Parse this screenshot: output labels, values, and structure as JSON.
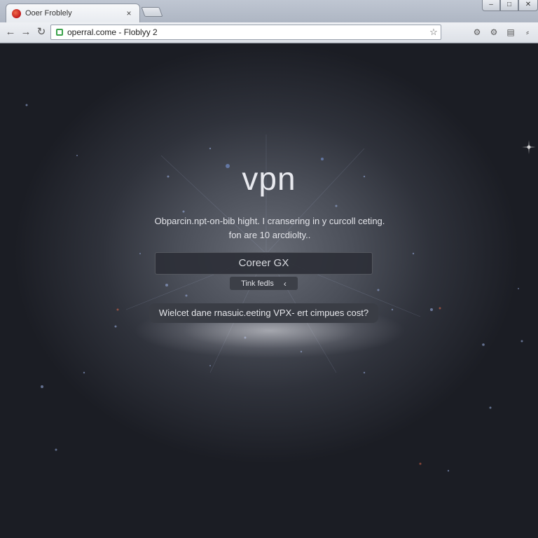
{
  "browser": {
    "tab": {
      "title": "Ooer Froblely",
      "close": "×"
    },
    "window_controls": [
      "–",
      "□",
      "✕"
    ],
    "address_bar": {
      "url": "operral.come - Floblyy 2"
    },
    "nav": {
      "back": "←",
      "forward": "→",
      "reload": "↻"
    },
    "star": "☆",
    "toolbar_icons": [
      "⚙",
      "⚙",
      "▤",
      "⸗"
    ]
  },
  "page": {
    "title": "vpn",
    "description_line1": "Obparcin.npt-on-bib hight. I cransering in y curcoll ceting.",
    "description_line2": "fon are 10 arcdiolty..",
    "primary_button": "Coreer GX",
    "secondary_button": {
      "label": "Tink fedls",
      "icon": "‹"
    },
    "question_pill": "Wielcet dane rnasuic.eeting VPX- ert cimpues cost?"
  },
  "colors": {
    "background": "#1d1f26",
    "glow": "#f0f0f5",
    "favicon": "#c0181a",
    "secure": "#3aa24a"
  }
}
